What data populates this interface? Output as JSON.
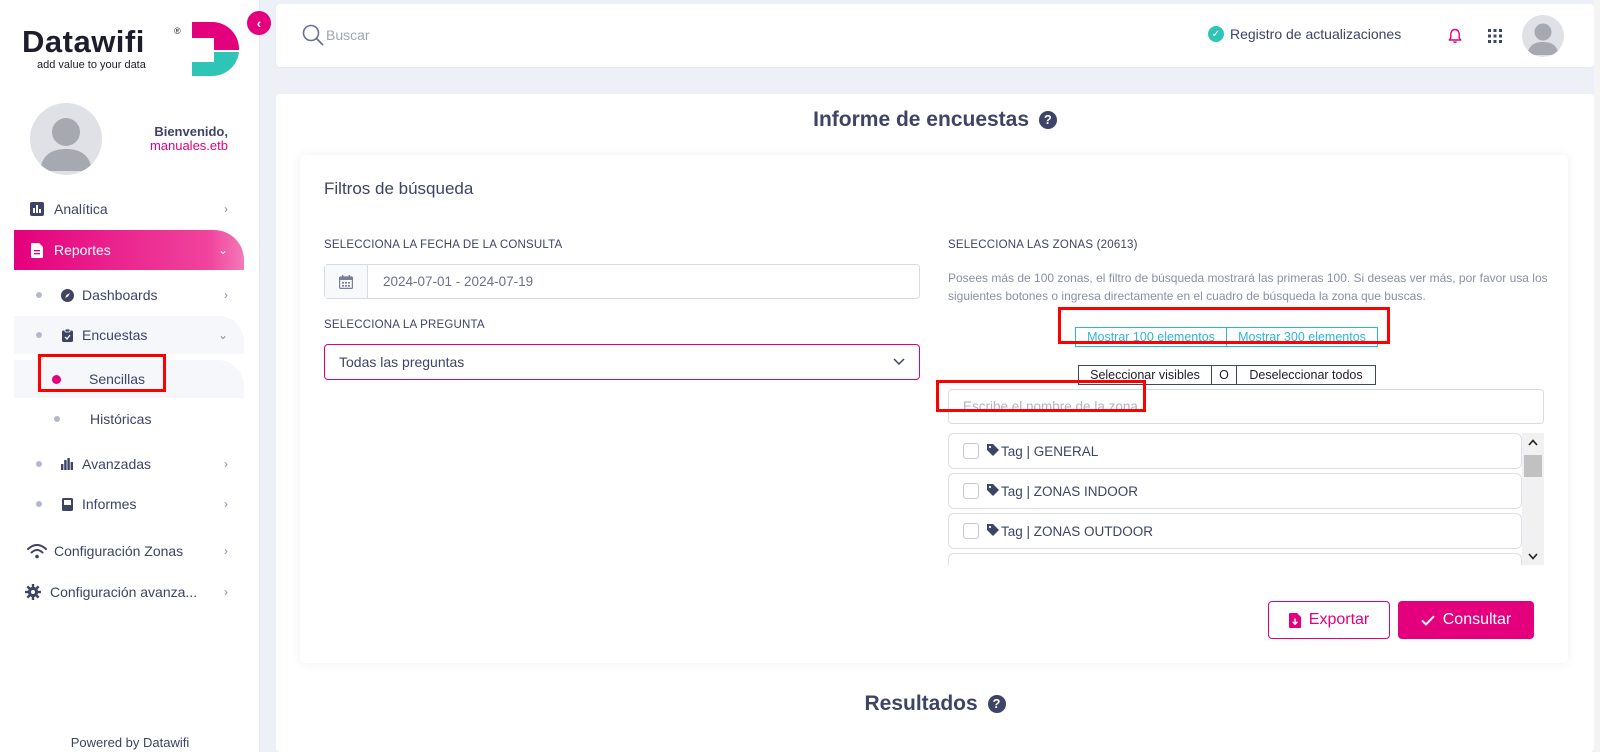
{
  "brand": {
    "name": "Datawifi",
    "registered": "®",
    "tagline": "add value to your data",
    "colors": {
      "primary": "#e4007c",
      "teal": "#2ec4b6",
      "text": "#3d4465"
    }
  },
  "user": {
    "welcome": "Bienvenido,",
    "username": "manuales.etb"
  },
  "sidebar": {
    "items": [
      {
        "label": "Analítica",
        "icon": "chart-icon"
      },
      {
        "label": "Reportes",
        "icon": "document-icon"
      },
      {
        "label": "Configuración Zonas",
        "icon": "wifi-icon"
      },
      {
        "label": "Configuración avanza...",
        "icon": "gear-icon"
      }
    ],
    "reportes_sub": [
      {
        "label": "Dashboards",
        "icon": "compass-icon"
      },
      {
        "label": "Encuestas",
        "icon": "clipboard-icon"
      },
      {
        "label": "Avanzadas",
        "icon": "bar-chart-icon"
      },
      {
        "label": "Informes",
        "icon": "book-icon"
      }
    ],
    "encuestas_sub": [
      {
        "label": "Sencillas"
      },
      {
        "label": "Históricas"
      }
    ],
    "powered_by": "Powered by Datawifi"
  },
  "header": {
    "search_placeholder": "Buscar",
    "updates_label": "Registro de actualizaciones"
  },
  "page": {
    "title": "Informe de encuestas",
    "help": "?",
    "results_title": "Resultados"
  },
  "filters": {
    "title": "Filtros de búsqueda",
    "date_label": "SELECCIONA LA FECHA DE LA CONSULTA",
    "date_value": "2024-07-01 - 2024-07-19",
    "question_label": "SELECCIONA LA PREGUNTA",
    "question_value": "Todas las preguntas",
    "zones_label": "SELECCIONA LAS ZONAS (20613)",
    "zones_help": "Posees más de 100 zonas, el filtro de búsqueda mostrará las primeras 100. Si deseas ver más, por favor usa los siguientes botones o ingresa directamente en el cuadro de búsqueda la zona que buscas.",
    "show_100": "Mostrar 100 elementos",
    "show_300": "Mostrar 300 elementos",
    "select_visible": "Seleccionar visibles",
    "or": "O",
    "deselect_all": "Deseleccionar todos",
    "zone_search_placeholder": "Escribe el nombre de la zona",
    "zones": [
      {
        "label": "Tag | GENERAL"
      },
      {
        "label": "Tag | ZONAS INDOOR"
      },
      {
        "label": "Tag | ZONAS OUTDOOR"
      }
    ],
    "export_label": "Exportar",
    "consult_label": "Consultar"
  }
}
